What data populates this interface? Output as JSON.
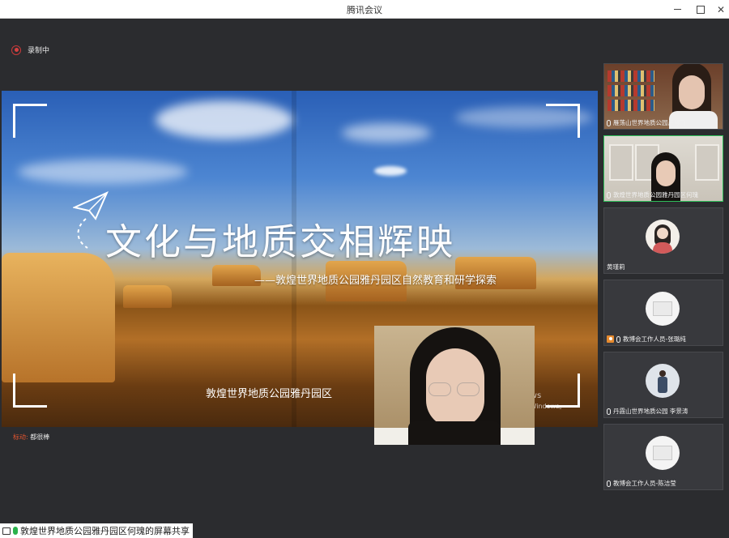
{
  "window": {
    "title": "腾讯会议"
  },
  "recording": {
    "label": "录制中"
  },
  "slide": {
    "title": "文化与地质交相辉映",
    "subtitle": "——敦煌世界地质公园雅丹园区自然教育和研学探索",
    "organization": "敦煌世界地质公园雅丹园区",
    "presenter": "何瑰",
    "watermark_line1": "ndows",
    "watermark_line2": "激活 Windows。"
  },
  "annotator": {
    "key": "标动:",
    "value": "都很棒"
  },
  "share_bar": {
    "text": "敦煌世界地质公园雅丹园区何瑰的屏幕共享"
  },
  "participants": [
    {
      "name": "雁荡山世界地质公园卢琴飞",
      "type": "video",
      "active": false
    },
    {
      "name": "敦煌世界地质公园雅丹园区何瑰",
      "type": "video",
      "active": true
    },
    {
      "name": "黄瑾莉",
      "type": "avatar",
      "active": false
    },
    {
      "name": "教博会工作人员-张璐纯",
      "type": "avatar",
      "host": true,
      "active": false
    },
    {
      "name": "丹霞山世界地质公园 李景涛",
      "type": "avatar",
      "active": false
    },
    {
      "name": "教博会工作人员-陈洁莹",
      "type": "avatar",
      "active": false
    }
  ],
  "colors": {
    "active_border": "#2fbf5a",
    "record": "#d84242",
    "host": "#e68a2e",
    "mic_share": "#2bb24c"
  }
}
